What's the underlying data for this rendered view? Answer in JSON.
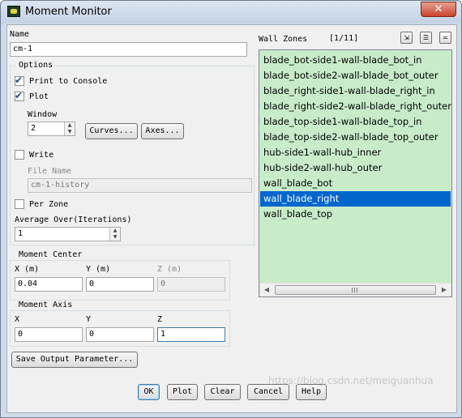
{
  "window": {
    "title": "Moment Monitor",
    "close_label": "✕"
  },
  "name": {
    "label": "Name",
    "value": "cm-1"
  },
  "options": {
    "title": "Options",
    "print_to_console": {
      "label": "Print to Console",
      "checked": true
    },
    "plot": {
      "label": "Plot",
      "checked": true
    },
    "window_label": "Window",
    "window_value": "2",
    "curves_label": "Curves...",
    "axes_label": "Axes...",
    "write": {
      "label": "Write",
      "checked": false
    },
    "file_name_label": "File Name",
    "file_name_value": "cm-1-history",
    "per_zone": {
      "label": "Per Zone",
      "checked": false
    },
    "average_over_label": "Average Over(Iterations)",
    "average_over_value": "1"
  },
  "moment_center": {
    "title": "Moment Center",
    "x_label": "X (m)",
    "y_label": "Y (m)",
    "z_label": "Z (m)",
    "x_value": "0.04",
    "y_value": "0",
    "z_value": "0"
  },
  "moment_axis": {
    "title": "Moment Axis",
    "x_label": "X",
    "y_label": "Y",
    "z_label": "Z",
    "x_value": "0",
    "y_value": "0",
    "z_value": "1"
  },
  "save_output_label": "Save Output Parameter...",
  "wall_zones": {
    "label": "Wall Zones",
    "count": "[1/11]",
    "selected_index": 9,
    "items": [
      "blade_bot-side1-wall-blade_bot_in",
      "blade_bot-side2-wall-blade_bot_outer",
      "blade_right-side1-wall-blade_right_in",
      "blade_right-side2-wall-blade_right_outer",
      "blade_top-side1-wall-blade_top_in",
      "blade_top-side2-wall-blade_top_outer",
      "hub-side1-wall-hub_inner",
      "hub-side2-wall-hub_outer",
      "wall_blade_bot",
      "wall_blade_right",
      "wall_blade_top"
    ]
  },
  "footer": {
    "ok": "OK",
    "plot": "Plot",
    "clear": "Clear",
    "cancel": "Cancel",
    "help": "Help"
  },
  "watermark": "https://blog.csdn.net/meiguanhua",
  "colors": {
    "list_background": "#c8ecca",
    "selection": "#0066cc"
  }
}
